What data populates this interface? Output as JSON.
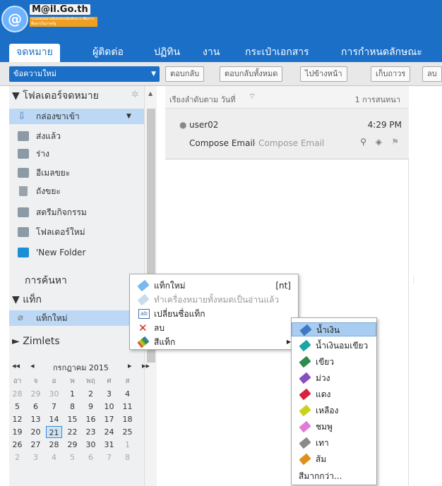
{
  "brand": {
    "logo_initial": "@",
    "name": "M@il.Go.th",
    "tagline": "ระบบจดหมายอิเล็กทรอนิกส์กลาง เพื่อการสื่อสารในภาครัฐ"
  },
  "tabs": [
    {
      "label": "จดหมาย"
    },
    {
      "label": "ผู้ติดต่อ"
    },
    {
      "label": "ปฏิทิน"
    },
    {
      "label": "งาน"
    },
    {
      "label": "กระเป๋าเอกสาร"
    },
    {
      "label": "การกำหนดลักษณะ"
    }
  ],
  "toolbar": {
    "new_message": "ข้อความใหม่",
    "reply": "ตอบกลับ",
    "reply_all": "ตอบกลับทั้งหมด",
    "forward": "ไปข้างหน้า",
    "archive": "เก็บถาวร",
    "delete": "ลบ"
  },
  "sidebar": {
    "mail_folders_heading": "โฟลเดอร์จดหมาย",
    "folders": [
      {
        "label": "กล่องขาเข้า",
        "icon": "inbox-icon"
      },
      {
        "label": "ส่งแล้ว",
        "icon": "sent-icon"
      },
      {
        "label": "ร่าง",
        "icon": "drafts-icon"
      },
      {
        "label": "อีเมลขยะ",
        "icon": "junk-icon"
      },
      {
        "label": "ถังขยะ",
        "icon": "trash-icon"
      },
      {
        "label": "สตรีมกิจกรรม",
        "icon": "folder-icon"
      },
      {
        "label": "โฟลเดอร์ใหม่",
        "icon": "folder-icon"
      },
      {
        "label": "'New Folder",
        "icon": "folder-blue-icon"
      }
    ],
    "search_heading": "การค้นหา",
    "tags_heading": "แท็ก",
    "tag_item": "แท็กใหม่",
    "zimlets_heading": "Zimlets"
  },
  "calendar": {
    "month_label": "กรกฎาคม 2015",
    "days_of_week": [
      "อา",
      "จ",
      "อ",
      "พ",
      "พฤ",
      "ศ",
      "ส"
    ],
    "weeks": [
      [
        "28",
        "29",
        "30",
        "1",
        "2",
        "3",
        "4"
      ],
      [
        "5",
        "6",
        "7",
        "8",
        "9",
        "10",
        "11"
      ],
      [
        "12",
        "13",
        "14",
        "15",
        "16",
        "17",
        "18"
      ],
      [
        "19",
        "20",
        "21",
        "22",
        "23",
        "24",
        "25"
      ],
      [
        "26",
        "27",
        "28",
        "29",
        "30",
        "31",
        "1"
      ],
      [
        "2",
        "3",
        "4",
        "5",
        "6",
        "7",
        "8"
      ]
    ],
    "today": "21"
  },
  "message_list": {
    "sort_label": "เรียงลำดับตาม วันที่",
    "count_label": "1 การสนทนา",
    "messages": [
      {
        "sender": "user02",
        "time": "4:29 PM",
        "subject": "Compose Email",
        "preview": "- Compose Email"
      }
    ]
  },
  "tag_context_menu": {
    "items": [
      {
        "label": "แท็กใหม่",
        "shortcut": "[nt]",
        "icon": "new-tag-icon",
        "disabled": false
      },
      {
        "label": "ทำเครื่องหมายทั้งหมดเป็นอ่านแล้ว",
        "icon": "mark-read-icon",
        "disabled": true
      },
      {
        "label": "เปลี่ยนชื่อแท็ก",
        "icon": "rename-icon",
        "disabled": false
      },
      {
        "label": "ลบ",
        "icon": "delete-x-icon",
        "disabled": false
      },
      {
        "label": "สีแท็ก",
        "icon": "tag-color-icon",
        "disabled": false
      }
    ]
  },
  "color_submenu": {
    "items": [
      {
        "label": "น้ำเงิน",
        "color": "#3f78c6"
      },
      {
        "label": "น้ำเงินอมเขียว",
        "color": "#1aa6a6"
      },
      {
        "label": "เขียว",
        "color": "#2e8b4a"
      },
      {
        "label": "ม่วง",
        "color": "#8a4fbf"
      },
      {
        "label": "แดง",
        "color": "#d8233b"
      },
      {
        "label": "เหลือง",
        "color": "#c9d21a"
      },
      {
        "label": "ชมพู",
        "color": "#e07bd8"
      },
      {
        "label": "เทา",
        "color": "#8a8a8a"
      },
      {
        "label": "ส้ม",
        "color": "#e0901a"
      }
    ],
    "more_label": "สีมากกว่า..."
  }
}
